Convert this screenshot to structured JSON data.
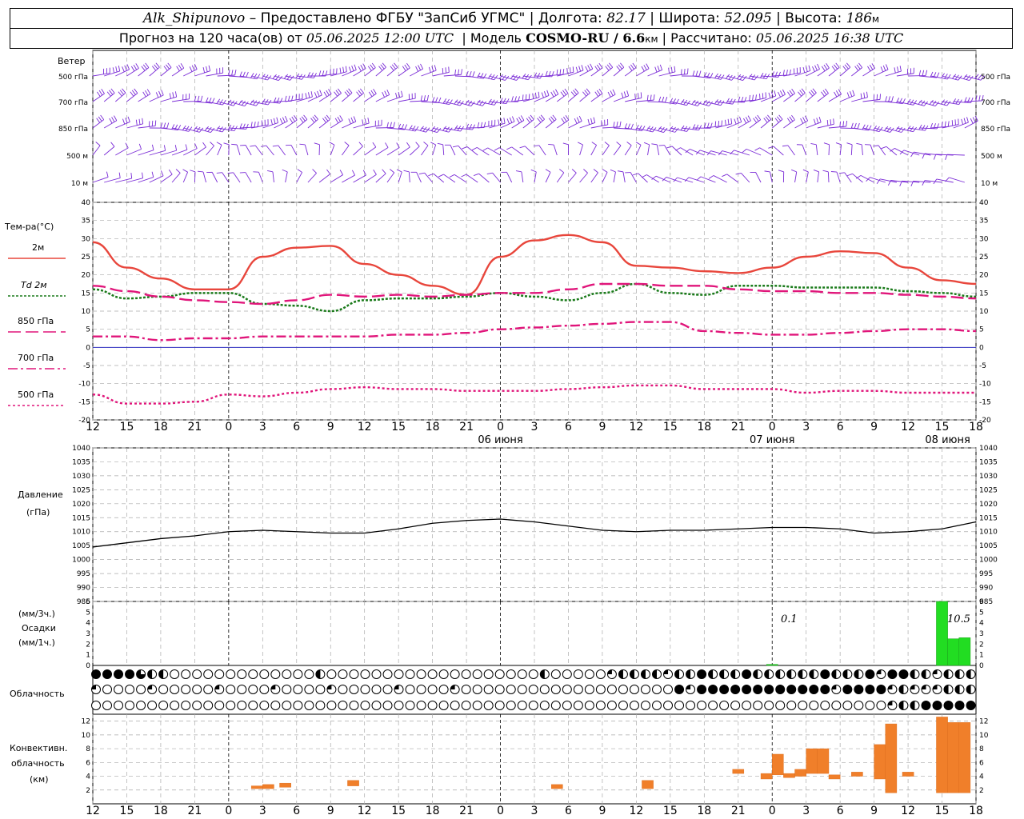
{
  "header": {
    "station": "Alk_Shipunovo",
    "provider": "– Предоставлено ФГБУ \"ЗапСиб УГМС\" |",
    "lon_label": "Долгота:",
    "lon": "82.17",
    "lat_label": "| Широта:",
    "lat": "52.095",
    "alt_label": "| Высота:",
    "alt": "186",
    "alt_unit": "м",
    "forecast_label": "Прогноз на 120 часа(ов) от",
    "forecast_start": "05.06.2025 12:00 UTC",
    "model_label": "| Модель",
    "model_name": "COSMO-RU / 6.6",
    "model_unit": "км",
    "calc_label": "| Рассчитано:",
    "calc_time": "05.06.2025 16:38 UTC"
  },
  "wind_panel": {
    "title": "Ветер",
    "levels": [
      "500 гПа",
      "700 гПа",
      "850 гПа",
      "500 м",
      "10  м"
    ]
  },
  "temp_panel": {
    "title": "Тем-ра(°C)",
    "legend": [
      {
        "label": "2м",
        "color": "#e8463c",
        "dash": ""
      },
      {
        "label": "Td  2м",
        "color": "#1a7a1a",
        "dash": "3,2"
      },
      {
        "label": "850 гПа",
        "color": "#e0157a",
        "dash": "16,6"
      },
      {
        "label": "700 гПа",
        "color": "#e0157a",
        "dash": "12,4,3,4"
      },
      {
        "label": "500 гПа",
        "color": "#e0157a",
        "dash": "3,3"
      }
    ]
  },
  "pressure_panel": {
    "title_line1": "Давление",
    "title_line2": "(гПа)"
  },
  "precip_panel": {
    "title_line1": "(мм/3ч.)",
    "title_line2": "Осадки",
    "title_line3": "(мм/1ч.)",
    "annotations": [
      "0.1",
      "10.5"
    ]
  },
  "cloud_panel": {
    "title": "Облачность"
  },
  "conv_panel": {
    "title_line1": "Конвективн.",
    "title_line2": "облачность",
    "title_line3": "(км)"
  },
  "x_axis": {
    "hour_labels": [
      "12",
      "15",
      "18",
      "21",
      "0",
      "3",
      "6",
      "9",
      "12",
      "15",
      "18",
      "21",
      "0",
      "3",
      "6",
      "9",
      "12",
      "15",
      "18",
      "21",
      "0",
      "3",
      "6",
      "9",
      "12",
      "15",
      "18"
    ],
    "date_labels": [
      "06 июня",
      "07 июня",
      "08 июня"
    ]
  },
  "chart_data": [
    {
      "type": "line",
      "title": "Тем-ра(°C)",
      "x_hours": [
        0,
        3,
        6,
        9,
        12,
        15,
        18,
        21,
        24,
        27,
        30,
        33,
        36,
        39,
        42,
        45,
        48,
        51,
        54,
        57,
        60,
        63,
        66,
        69,
        72,
        75,
        78
      ],
      "ylim": [
        -20,
        40
      ],
      "y_ticks": [
        -20,
        -15,
        -10,
        -5,
        0,
        5,
        10,
        15,
        20,
        25,
        30,
        35,
        40
      ],
      "series": [
        {
          "name": "2м",
          "values": [
            29,
            22,
            19,
            16,
            16,
            25,
            27.5,
            28,
            23,
            20,
            17,
            14.5,
            25,
            29.5,
            31,
            29,
            22.5,
            22,
            21,
            20.5,
            22,
            25,
            26.5,
            26,
            22,
            18.5,
            17.5
          ]
        },
        {
          "name": "Td  2м",
          "values": [
            16,
            13.5,
            14,
            15,
            15,
            12,
            11.5,
            10,
            13,
            13.5,
            13.5,
            14,
            15,
            14,
            13,
            15,
            17.5,
            15,
            14.5,
            17,
            17,
            16.5,
            16.5,
            16.5,
            15.5,
            15,
            14
          ]
        },
        {
          "name": "850 гПа",
          "values": [
            17,
            15.5,
            14,
            13,
            12.5,
            12,
            13,
            14.5,
            14,
            14.5,
            14,
            14.5,
            15,
            15,
            16,
            17.5,
            17.5,
            17,
            17,
            16,
            15.5,
            15.5,
            15,
            15,
            14.5,
            14,
            13.5
          ]
        },
        {
          "name": "700 гПа",
          "values": [
            3,
            3,
            2,
            2.5,
            2.5,
            3,
            3,
            3,
            3,
            3.5,
            3.5,
            4,
            5,
            5.5,
            6,
            6.5,
            7,
            7,
            4.5,
            4,
            3.5,
            3.5,
            4,
            4.5,
            5,
            5,
            4.5
          ]
        },
        {
          "name": "500 гПа",
          "values": [
            -13,
            -15.5,
            -15.5,
            -15,
            -13,
            -13.5,
            -12.5,
            -11.5,
            -11,
            -11.5,
            -11.5,
            -12,
            -12,
            -12,
            -11.5,
            -11,
            -10.5,
            -10.5,
            -11.5,
            -11.5,
            -11.5,
            -12.5,
            -12,
            -12,
            -12.5,
            -12.5,
            -12.5
          ]
        }
      ]
    },
    {
      "type": "line",
      "title": "Давление",
      "x_hours": [
        0,
        3,
        6,
        9,
        12,
        15,
        18,
        21,
        24,
        27,
        30,
        33,
        36,
        39,
        42,
        45,
        48,
        51,
        54,
        57,
        60,
        63,
        66,
        69,
        72,
        75,
        78
      ],
      "ylim": [
        985,
        1040
      ],
      "y_ticks": [
        985,
        990,
        995,
        1000,
        1005,
        1010,
        1015,
        1020,
        1025,
        1030,
        1035,
        1040
      ],
      "series": [
        {
          "name": "Давление",
          "values": [
            1004.5,
            1006,
            1007.5,
            1008.5,
            1010,
            1010.5,
            1010,
            1009.5,
            1009.5,
            1011,
            1013,
            1014,
            1014.5,
            1013.5,
            1012,
            1010.5,
            1010,
            1010.5,
            1010.5,
            1011,
            1011.5,
            1011.5,
            1011,
            1009.5,
            1010,
            1011,
            1013.5
          ]
        }
      ]
    },
    {
      "type": "bar",
      "title": "Осадки",
      "ylim": [
        0,
        6
      ],
      "y_ticks": [
        0,
        1,
        2,
        3,
        4,
        5,
        6
      ],
      "bars": [
        {
          "x": 60,
          "value": 0.1
        },
        {
          "x": 75,
          "value": 6
        },
        {
          "x": 76,
          "value": 2.5
        },
        {
          "x": 77,
          "value": 2.6
        }
      ]
    },
    {
      "type": "bar",
      "title": "Конвективн. облачность",
      "ylim": [
        0,
        13
      ],
      "y_ticks": [
        2,
        4,
        6,
        8,
        10,
        12
      ],
      "bars": [
        {
          "x": 14.5,
          "base": 2.2,
          "top": 2.6
        },
        {
          "x": 15.5,
          "base": 2.2,
          "top": 2.8
        },
        {
          "x": 17,
          "base": 2.4,
          "top": 3.0
        },
        {
          "x": 23,
          "base": 2.6,
          "top": 3.4
        },
        {
          "x": 41,
          "base": 2.2,
          "top": 2.8
        },
        {
          "x": 49,
          "base": 2.2,
          "top": 3.4
        },
        {
          "x": 57,
          "base": 4.4,
          "top": 5.0
        },
        {
          "x": 59.5,
          "base": 3.6,
          "top": 4.4
        },
        {
          "x": 60.5,
          "base": 4.2,
          "top": 7.2
        },
        {
          "x": 61.5,
          "base": 3.8,
          "top": 4.4
        },
        {
          "x": 62.5,
          "base": 4.0,
          "top": 5.0
        },
        {
          "x": 63.5,
          "base": 4.4,
          "top": 8.0
        },
        {
          "x": 64.5,
          "base": 4.4,
          "top": 8.0
        },
        {
          "x": 65.5,
          "base": 3.6,
          "top": 4.2
        },
        {
          "x": 67.5,
          "base": 4.0,
          "top": 4.6
        },
        {
          "x": 69.5,
          "base": 3.6,
          "top": 8.6
        },
        {
          "x": 70.5,
          "base": 1.6,
          "top": 11.6
        },
        {
          "x": 72,
          "base": 4.0,
          "top": 4.6
        },
        {
          "x": 75,
          "base": 1.6,
          "top": 12.6
        },
        {
          "x": 76,
          "base": 1.6,
          "top": 11.8
        },
        {
          "x": 77,
          "base": 1.6,
          "top": 11.8
        }
      ]
    }
  ],
  "colors": {
    "wind": "#7a2bd6",
    "precip": "#22dd22",
    "conv": "#f07f2a",
    "zero_line": "#3030c0"
  }
}
